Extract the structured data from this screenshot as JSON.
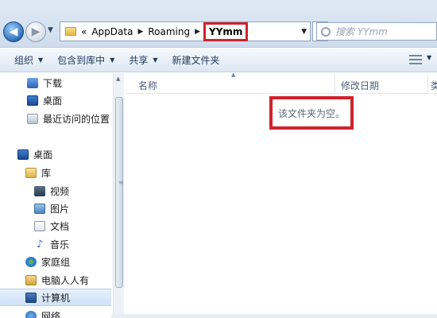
{
  "address_bar": {
    "overflow_chevron": "«",
    "segments": [
      "AppData",
      "Roaming"
    ],
    "current": "YYmm",
    "search_placeholder": "搜索 YYmm"
  },
  "toolbar": {
    "organize": "组织",
    "include_in_library": "包含到库中",
    "share": "共享",
    "new_folder": "新建文件夹"
  },
  "nav_pane": {
    "items": [
      {
        "label": "下载",
        "icon": "download-folder-icon"
      },
      {
        "label": "桌面",
        "icon": "desktop-icon"
      },
      {
        "label": "最近访问的位置",
        "icon": "recent-places-icon"
      },
      {
        "label": "桌面",
        "icon": "desktop-icon"
      },
      {
        "label": "库",
        "icon": "library-icon"
      },
      {
        "label": "视频",
        "icon": "videos-icon"
      },
      {
        "label": "图片",
        "icon": "pictures-icon"
      },
      {
        "label": "文档",
        "icon": "documents-icon"
      },
      {
        "label": "音乐",
        "icon": "music-icon"
      },
      {
        "label": "家庭组",
        "icon": "homegroup-icon"
      },
      {
        "label": "电脑人人有",
        "icon": "user-folder-icon"
      },
      {
        "label": "计算机",
        "icon": "computer-icon"
      },
      {
        "label": "网络",
        "icon": "network-icon"
      }
    ]
  },
  "content": {
    "columns": {
      "name": "名称",
      "date_modified": "修改日期",
      "more": "类"
    },
    "empty_message": "该文件夹为空。"
  },
  "colors": {
    "highlight_border": "#d0222d",
    "toolbar_bg": "#dde7f2",
    "accent_blue": "#2f6fb8"
  }
}
